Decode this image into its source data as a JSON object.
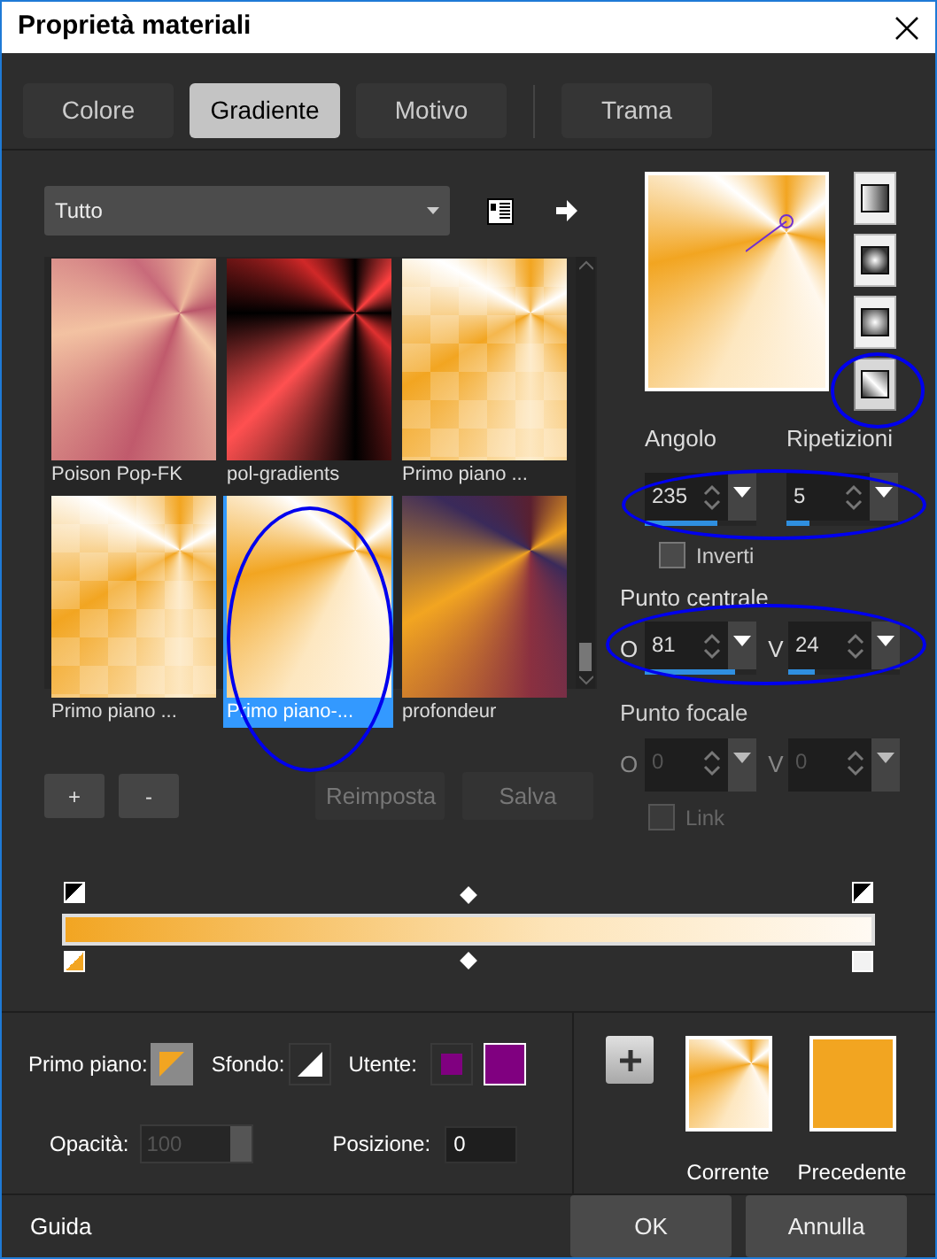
{
  "window": {
    "title": "Proprietà materiali"
  },
  "tabs": [
    {
      "label": "Colore",
      "selected": false
    },
    {
      "label": "Gradiente",
      "selected": true
    },
    {
      "label": "Motivo",
      "selected": false
    },
    {
      "label": "Trama",
      "selected": false
    }
  ],
  "category_dropdown": {
    "value": "Tutto"
  },
  "gradients": [
    {
      "label": "Poison Pop-FK",
      "selected": false
    },
    {
      "label": "pol-gradients",
      "selected": false
    },
    {
      "label": "Primo piano ...",
      "selected": false
    },
    {
      "label": "Primo piano ...",
      "selected": false
    },
    {
      "label": "Primo piano-...",
      "selected": true
    },
    {
      "label": "profondeur",
      "selected": false
    }
  ],
  "stop_buttons": [
    "+",
    "-"
  ],
  "actions": [
    {
      "label": "Reimposta",
      "disabled": true
    },
    {
      "label": "Salva",
      "disabled": true
    }
  ],
  "style_buttons": [
    {
      "kind": "linear",
      "selected": false
    },
    {
      "kind": "rectangular",
      "selected": false
    },
    {
      "kind": "radial",
      "selected": false
    },
    {
      "kind": "sunburst",
      "selected": true
    }
  ],
  "angle": {
    "label": "Angolo",
    "value": "235",
    "level": 0.65
  },
  "repeats": {
    "label": "Ripetizioni",
    "value": "5",
    "level": 0.2
  },
  "invert": {
    "label": "Inverti",
    "checked": false
  },
  "center": {
    "label": "Punto centrale",
    "fields": [
      {
        "axis": "O",
        "value": "81",
        "level": 0.81
      },
      {
        "axis": "V",
        "value": "24",
        "level": 0.24
      }
    ]
  },
  "focal": {
    "label": "Punto focale",
    "disabled": true,
    "fields": [
      {
        "axis": "O",
        "value": "0"
      },
      {
        "axis": "V",
        "value": "0"
      }
    ]
  },
  "link": {
    "label": "Link",
    "checked": false,
    "disabled": true
  },
  "sources": [
    {
      "label": "Primo piano:",
      "kind": "foreground"
    },
    {
      "label": "Sfondo:",
      "kind": "background"
    },
    {
      "label": "Utente:",
      "kind": "user",
      "color": "#800080"
    }
  ],
  "opacity": {
    "label": "Opacità:",
    "value": "100",
    "disabled": true
  },
  "position": {
    "label": "Posizione:",
    "value": "0"
  },
  "comparison": [
    {
      "label": "Corrente",
      "kind": "gradient"
    },
    {
      "label": "Precedente",
      "kind": "solid",
      "color": "#f2a521"
    }
  ],
  "help": "Guida",
  "buttons": [
    "OK",
    "Annulla"
  ]
}
